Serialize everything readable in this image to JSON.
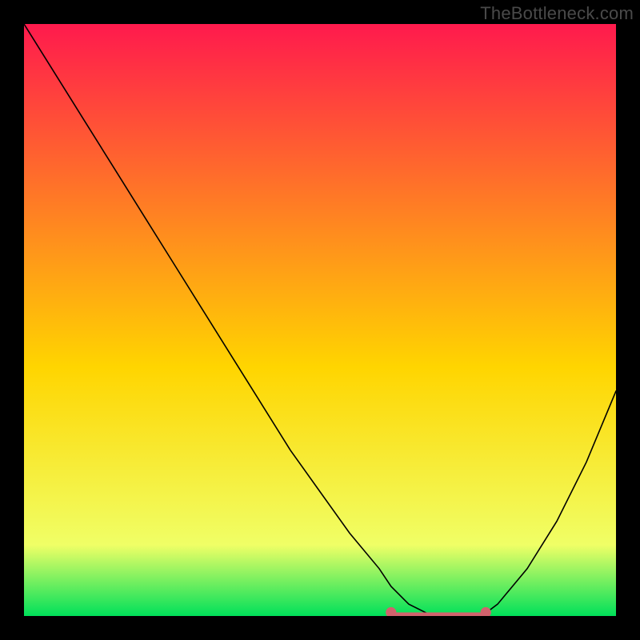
{
  "watermark": "TheBottleneck.com",
  "chart_data": {
    "type": "line",
    "title": "",
    "xlabel": "",
    "ylabel": "",
    "xlim": [
      0,
      100
    ],
    "ylim": [
      0,
      100
    ],
    "grid": false,
    "legend": false,
    "annotations": [],
    "gradient": {
      "top_color": "#ff1a4d",
      "mid_color": "#ffd500",
      "bottom_color": "#00e05a"
    },
    "curve": {
      "description": "V-shaped bottleneck curve; y is mismatch/bottleneck percentage, x is component balance axis (arbitrary). Minimum plateau around x≈70.",
      "x": [
        0,
        5,
        10,
        15,
        20,
        25,
        30,
        35,
        40,
        45,
        50,
        55,
        60,
        62,
        65,
        68,
        70,
        72,
        74,
        76,
        78,
        80,
        85,
        90,
        95,
        100
      ],
      "y": [
        100,
        92,
        84,
        76,
        68,
        60,
        52,
        44,
        36,
        28,
        21,
        14,
        8,
        5,
        2,
        0.5,
        0,
        0,
        0,
        0,
        0.5,
        2,
        8,
        16,
        26,
        38
      ]
    },
    "flat_segment": {
      "description": "Highlighted optimal range where bottleneck is ~0%",
      "x_start": 62,
      "x_end": 78,
      "y": 0,
      "color": "#d1636d",
      "endpoint_radius_px": 6,
      "stroke_width_px": 9
    }
  }
}
